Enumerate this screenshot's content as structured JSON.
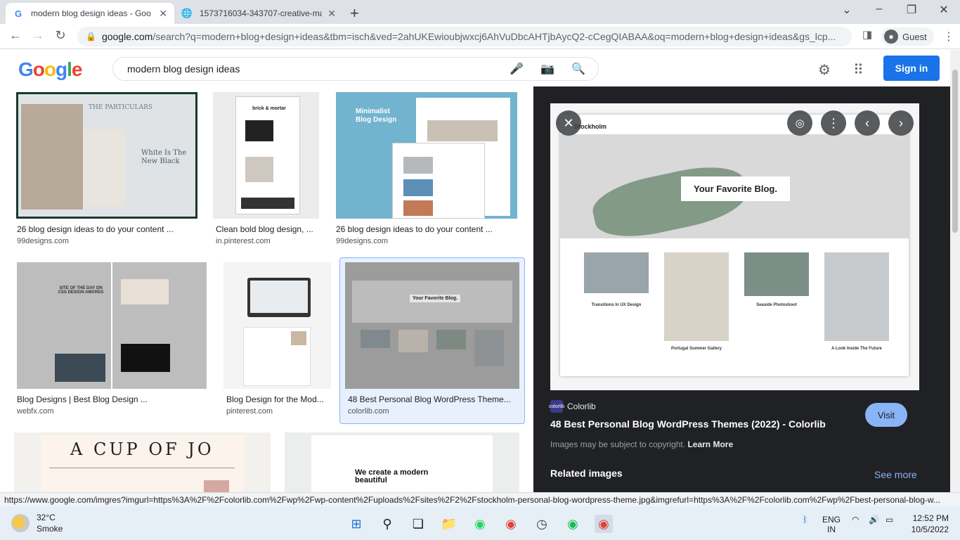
{
  "browser": {
    "tabs": [
      {
        "title": "modern blog design ideas - Goo",
        "favicon": "G",
        "active": true
      },
      {
        "title": "1573716034-343707-creative-ma",
        "favicon": "globe-icon",
        "active": false
      }
    ],
    "new_tab": "+",
    "window_controls": [
      "chevron-down-icon",
      "minimize-icon",
      "maximize-icon",
      "close-icon"
    ],
    "url_host": "google.com",
    "url_path": "/search?q=modern+blog+design+ideas&tbm=isch&ved=2ahUKEwioubjwxcj6AhVuDbcAHTjbAycQ2-cCegQIABAA&oq=modern+blog+design+ideas&gs_lcp...",
    "profile_label": "Guest"
  },
  "google": {
    "logo_letters": [
      {
        "ch": "G",
        "color": "#4285f4"
      },
      {
        "ch": "o",
        "color": "#ea4335"
      },
      {
        "ch": "o",
        "color": "#fbbc05"
      },
      {
        "ch": "g",
        "color": "#4285f4"
      },
      {
        "ch": "l",
        "color": "#34a853"
      },
      {
        "ch": "e",
        "color": "#ea4335"
      }
    ],
    "query": "modern blog design ideas",
    "sign_in": "Sign in"
  },
  "results": [
    {
      "caption": "26 blog design ideas to do your content ...",
      "source": "99designs.com",
      "thumb_text": "THE PARTICULARS · White Is The New Black"
    },
    {
      "caption": "Clean bold blog design, ...",
      "source": "in.pinterest.com",
      "thumb_text": "brick & mortar"
    },
    {
      "caption": "26 blog design ideas to do your content ...",
      "source": "99designs.com",
      "thumb_text": "Minimalist Blog Design"
    },
    {
      "caption": "Blog Designs | Best Blog Design ...",
      "source": "webfx.com",
      "thumb_text": "SITE OF THE DAY ON CSS DESIGN AWARDS"
    },
    {
      "caption": "Blog Design for the Mod...",
      "source": "pinterest.com",
      "thumb_text": ""
    },
    {
      "caption": "48 Best Personal Blog WordPress Theme...",
      "source": "colorlib.com",
      "thumb_text": "Your Favorite Blog."
    },
    {
      "caption": "",
      "source": "",
      "thumb_text": "A CUP OF JO"
    },
    {
      "caption": "",
      "source": "",
      "thumb_text": "We create a modern beautiful"
    }
  ],
  "viewer": {
    "image_heading": "Your Favorite Blog.",
    "brand": "Stockholm",
    "posts": [
      "Transitions In UX Design",
      "Portugal Summer Gallery",
      "Seaside Photoshoot",
      "A Look Inside The Future"
    ],
    "site_name": "Colorlib",
    "site_favicon": "colorlib",
    "title": "48 Best Personal Blog WordPress Themes (2022) - Colorlib",
    "visit": "Visit",
    "copyright": "Images may be subject to copyright.",
    "learn_more": "Learn More",
    "related": "Related images",
    "see_more": "See more"
  },
  "status_url": "https://www.google.com/imgres?imgurl=https%3A%2F%2Fcolorlib.com%2Fwp%2Fwp-content%2Fuploads%2Fsites%2F2%2Fstockholm-personal-blog-wordpress-theme.jpg&imgrefurl=https%3A%2F%2Fcolorlib.com%2Fwp%2Fbest-personal-blog-w...",
  "taskbar": {
    "temp": "32°C",
    "condition": "Smoke",
    "lang1": "ENG",
    "lang2": "IN",
    "time": "12:52 PM",
    "date": "10/5/2022"
  }
}
